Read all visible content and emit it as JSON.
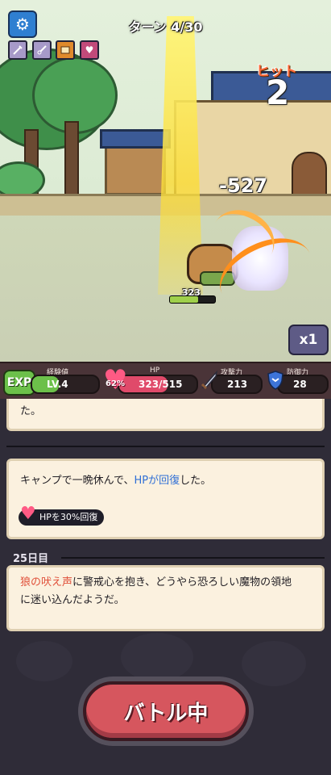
{
  "header": {
    "turn_label": "ターン 4/30",
    "hit_label": "ヒット",
    "hit_count": "2"
  },
  "battle": {
    "damage_number": "-527",
    "player_hp_number": "323",
    "player_hp_fraction": 0.62,
    "speed_label": "x1"
  },
  "skills": [
    {
      "name": "sword-skill-icon"
    },
    {
      "name": "scissors-skill-icon"
    },
    {
      "name": "scroll-skill-icon"
    },
    {
      "name": "heart-skill-icon"
    }
  ],
  "stats": {
    "exp": {
      "badge": "EXP",
      "label": "経験値",
      "level": "LV.4",
      "fill": 0.4
    },
    "hp": {
      "label": "HP",
      "percent": "62%",
      "value": "323/515",
      "fill": 0.62
    },
    "attack": {
      "label": "攻撃力",
      "value": "213"
    },
    "defense": {
      "label": "防御力",
      "value": "28"
    }
  },
  "log": {
    "partial_text": "た。",
    "camp_text_before": "キャンプで一晩休んで、",
    "camp_text_hp": "HPが回復",
    "camp_text_after": "した。",
    "camp_chip": "HPを30%回復",
    "day_label": "25日目",
    "event_red": "狼の吠え声",
    "event_rest_1": "に警戒心を抱き、どうやら恐ろしい魔物の領地",
    "event_rest_2": "に迷い込んだようだ。"
  },
  "battle_button": "バトル中",
  "colors": {
    "accent_red": "#d6565e",
    "hp_blue": "#2f6fd6",
    "exp_green": "#6cc04a",
    "heart_pink": "#ff5a84"
  }
}
